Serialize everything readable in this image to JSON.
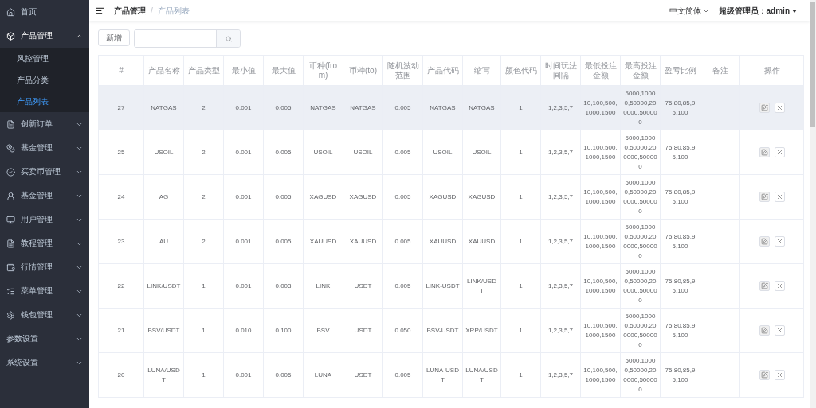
{
  "sidebar": {
    "items": [
      {
        "label": "首页",
        "kind": "link"
      },
      {
        "label": "产品管理",
        "kind": "group",
        "expanded": true,
        "children": [
          {
            "label": "风控管理",
            "selected": false
          },
          {
            "label": "产品分类",
            "selected": false
          },
          {
            "label": "产品列表",
            "selected": true
          }
        ]
      },
      {
        "label": "创新订单",
        "kind": "group",
        "expanded": false
      },
      {
        "label": "基金管理",
        "kind": "group",
        "expanded": false
      },
      {
        "label": "买卖币管理",
        "kind": "group",
        "expanded": false
      },
      {
        "label": "基金管理",
        "kind": "group",
        "expanded": false
      },
      {
        "label": "用户管理",
        "kind": "group",
        "expanded": false
      },
      {
        "label": "教程管理",
        "kind": "group",
        "expanded": false
      },
      {
        "label": "行情管理",
        "kind": "group",
        "expanded": false
      },
      {
        "label": "菜单管理",
        "kind": "group",
        "expanded": false
      },
      {
        "label": "钱包管理",
        "kind": "group",
        "expanded": false
      },
      {
        "label": "参数设置",
        "kind": "group",
        "expanded": false
      },
      {
        "label": "系统设置",
        "kind": "group",
        "expanded": false
      }
    ]
  },
  "header": {
    "breadcrumb": [
      "产品管理",
      "产品列表"
    ],
    "breadcrumb_separator": "/",
    "language": "中文简体",
    "user": "超级管理员：admin"
  },
  "toolbar": {
    "add_button": "新增"
  },
  "table": {
    "columns": [
      "#",
      "产品名称",
      "产品类型",
      "最小值",
      "最大值",
      "币种(from)",
      "币种(to)",
      "随机波动范围",
      "产品代码",
      "缩写",
      "颜色代码",
      "时间玩法间隔",
      "最低投注金额",
      "最高投注金额",
      "盈亏比例",
      "备注",
      "操作"
    ],
    "rows": [
      {
        "highlighted": true,
        "cells": [
          "27",
          "NATGAS",
          "2",
          "0.001",
          "0.005",
          "NATGAS",
          "NATGAS",
          "0.005",
          "NATGAS",
          "NATGAS",
          "1",
          "1,2,3,5,7",
          "10,100,500,1000,1500",
          "5000,10000,50000,200000,500000",
          "75,80,85,95,100",
          ""
        ]
      },
      {
        "highlighted": false,
        "cells": [
          "25",
          "USOIL",
          "2",
          "0.001",
          "0.005",
          "USOIL",
          "USOIL",
          "0.005",
          "USOIL",
          "USOIL",
          "1",
          "1,2,3,5,7",
          "10,100,500,1000,1500",
          "5000,10000,50000,200000,500000",
          "75,80,85,95,100",
          ""
        ]
      },
      {
        "highlighted": false,
        "cells": [
          "24",
          "AG",
          "2",
          "0.001",
          "0.005",
          "XAGUSD",
          "XAGUSD",
          "0.005",
          "XAGUSD",
          "XAGUSD",
          "1",
          "1,2,3,5,7",
          "10,100,500,1000,1500",
          "5000,10000,50000,200000,500000",
          "75,80,85,95,100",
          ""
        ]
      },
      {
        "highlighted": false,
        "cells": [
          "23",
          "AU",
          "2",
          "0.001",
          "0.005",
          "XAUUSD",
          "XAUUSD",
          "0.005",
          "XAUUSD",
          "XAUUSD",
          "1",
          "1,2,3,5,7",
          "10,100,500,1000,1500",
          "5000,10000,50000,200000,500000",
          "75,80,85,95,100",
          ""
        ]
      },
      {
        "highlighted": false,
        "cells": [
          "22",
          "LINK/USDT",
          "1",
          "0.001",
          "0.003",
          "LINK",
          "USDT",
          "0.005",
          "LINK-USDT",
          "LINK/USDT",
          "1",
          "1,2,3,5,7",
          "10,100,500,1000,1500",
          "5000,10000,50000,200000,500000",
          "75,80,85,95,100",
          ""
        ]
      },
      {
        "highlighted": false,
        "cells": [
          "21",
          "BSV/USDT",
          "1",
          "0.010",
          "0.100",
          "BSV",
          "USDT",
          "0.050",
          "BSV-USDT",
          "XRP/USDT",
          "1",
          "1,2,3,5,7",
          "10,100,500,1000,1500",
          "5000,10000,50000,200000,500000",
          "75,80,85,95,100",
          ""
        ]
      },
      {
        "highlighted": false,
        "cells": [
          "20",
          "LUNA/USDT",
          "1",
          "0.001",
          "0.005",
          "LUNA",
          "USDT",
          "0.005",
          "LUNA-USDT",
          "LUNA/USDT",
          "1",
          "1,2,3,5,7",
          "10,100,500,1000,1500",
          "5000,10000,50000,200000,500000",
          "75,80,85,95,100",
          ""
        ]
      }
    ]
  }
}
